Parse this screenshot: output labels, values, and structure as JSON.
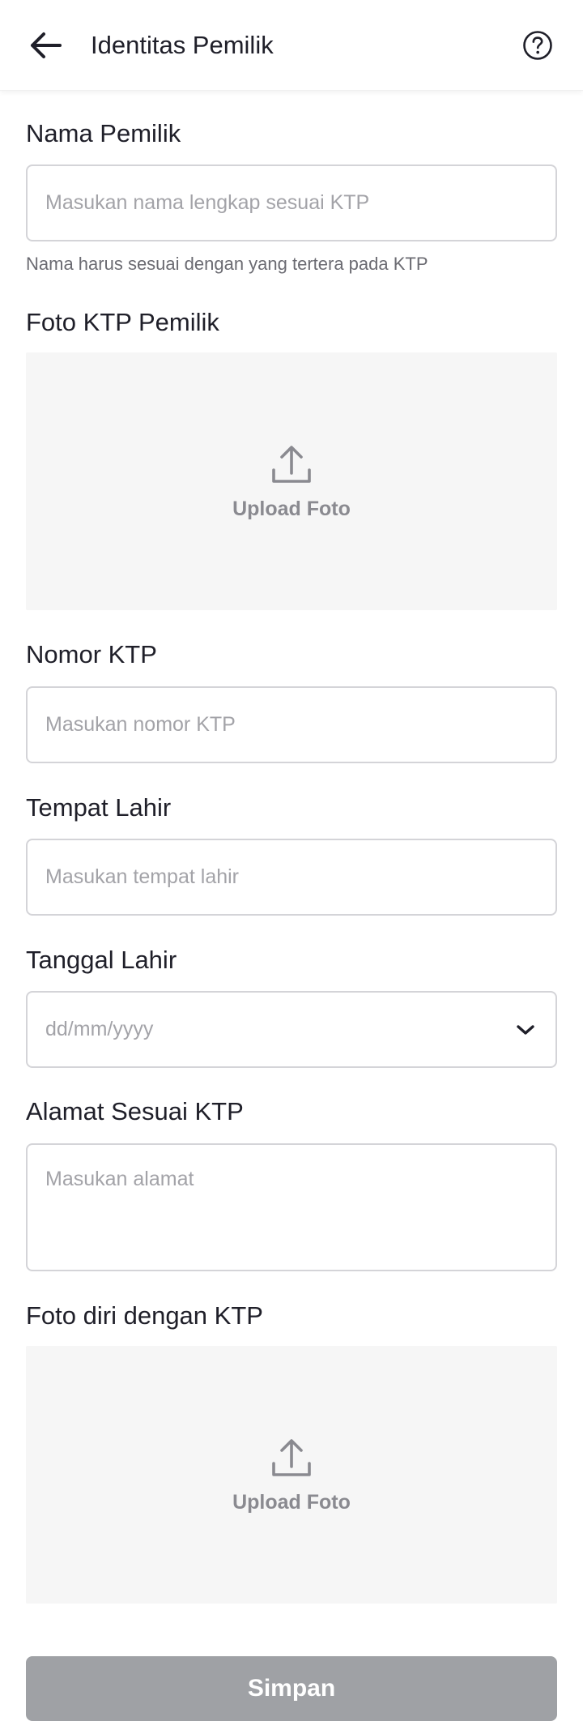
{
  "header": {
    "title": "Identitas Pemilik",
    "back_icon": "arrow-left-icon",
    "help_icon": "question-circle-icon"
  },
  "form": {
    "owner_name": {
      "label": "Nama Pemilik",
      "placeholder": "Masukan nama lengkap sesuai KTP",
      "value": "",
      "helper": "Nama harus sesuai dengan yang tertera pada KTP"
    },
    "ktp_photo": {
      "label": "Foto KTP Pemilik",
      "upload_label": "Upload Foto",
      "icon": "upload-icon"
    },
    "ktp_number": {
      "label": "Nomor KTP",
      "placeholder": "Masukan nomor KTP",
      "value": ""
    },
    "birth_place": {
      "label": "Tempat Lahir",
      "placeholder": "Masukan tempat lahir",
      "value": ""
    },
    "birth_date": {
      "label": "Tanggal Lahir",
      "placeholder": "dd/mm/yyyy",
      "icon": "chevron-down-icon"
    },
    "address": {
      "label": "Alamat Sesuai KTP",
      "placeholder": "Masukan alamat",
      "value": ""
    },
    "selfie_photo": {
      "label": "Foto diri dengan KTP",
      "upload_label": "Upload Foto",
      "icon": "upload-icon"
    }
  },
  "actions": {
    "save_label": "Simpan",
    "save_enabled": false
  },
  "colors": {
    "text_primary": "#1f1f29",
    "placeholder": "#a3a3a8",
    "border": "#d4d4d8",
    "upload_bg": "#f6f6f6",
    "button_disabled": "#9fa1a5"
  }
}
